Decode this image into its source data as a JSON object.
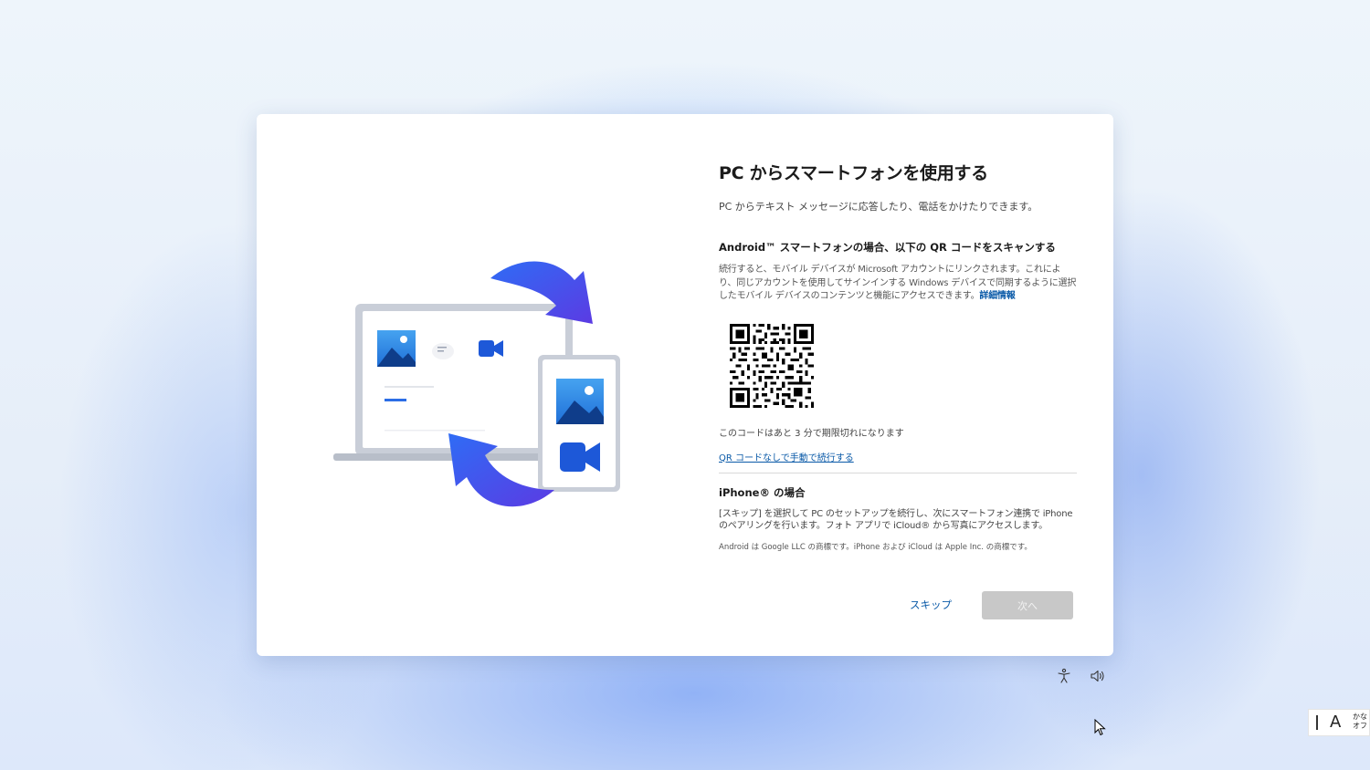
{
  "dialog": {
    "title": "PC からスマートフォンを使用する",
    "subtitle": "PC からテキスト メッセージに応答したり、電話をかけたりできます。",
    "android": {
      "heading": "Android™ スマートフォンの場合、以下の QR コードをスキャンする",
      "description": "続行すると、モバイル デバイスが Microsoft アカウントにリンクされます。これにより、同じアカウントを使用してサインインする Windows デバイスで同期するように選択したモバイル デバイスのコンテンツと機能にアクセスできます。",
      "learn_more_link": "詳細情報",
      "expire_text": "このコードはあと 3 分で期限切れになります",
      "manual_link": "QR コードなしで手動で続行する"
    },
    "iphone": {
      "heading": "iPhone® の場合",
      "description": "[スキップ] を選択して PC のセットアップを続行し、次にスマートフォン連携で iPhone のペアリングを行います。フォト アプリで iCloud® から写真にアクセスします。",
      "trademark": "Android は Google LLC の商標です。iPhone および iCloud は Apple Inc. の商標です。"
    },
    "buttons": {
      "skip": "スキップ",
      "next": "次へ"
    }
  },
  "system_tray": {
    "accessibility_icon": "accessibility-icon",
    "volume_icon": "volume-icon"
  },
  "ime": {
    "mode_letter": "A",
    "kana_line1": "かな",
    "kana_line2": "オフ"
  },
  "colors": {
    "accent": "#0a5aa8",
    "disabled_button": "#c8c8c8",
    "arrow_gradient_start": "#3a6cf0",
    "arrow_gradient_end": "#5a3fe0"
  }
}
